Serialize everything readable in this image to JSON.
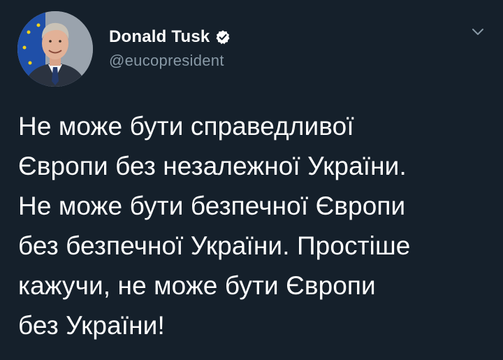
{
  "author": {
    "display_name": "Donald Tusk",
    "handle": "@eucopresident",
    "verified": true,
    "avatar_icon": "profile-photo"
  },
  "menu": {
    "icon": "chevron-down-icon"
  },
  "tweet": {
    "lines": [
      "Не може бути справедливої",
      "Європи без незалежної України.",
      "Не може бути безпечної Європи",
      "без безпечної України. Простіше",
      "кажучи, не може бути Європи",
      "без України!"
    ]
  },
  "colors": {
    "background": "#15202b",
    "primary_text": "#ffffff",
    "secondary_text": "#8899a6",
    "verified_badge": "#ffffff"
  }
}
